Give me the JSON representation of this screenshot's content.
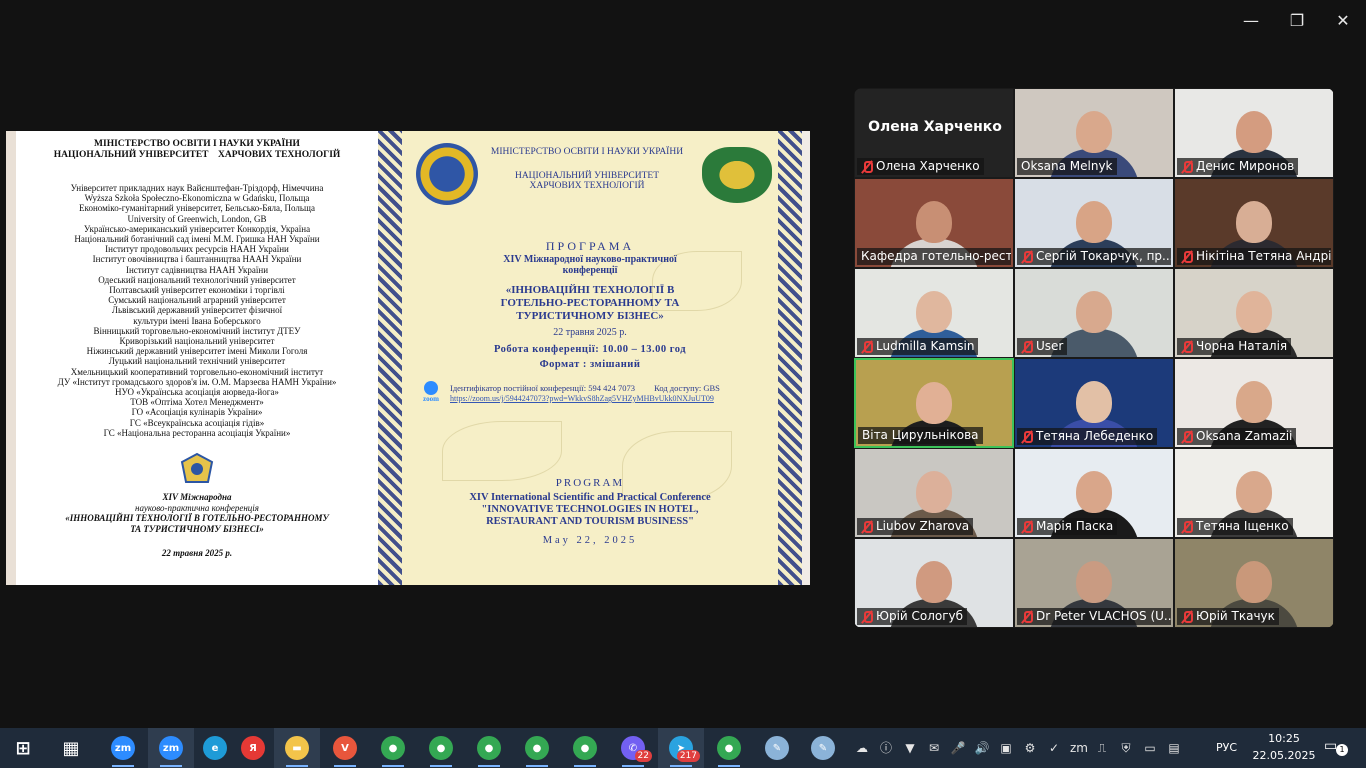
{
  "window": {
    "minimize": "—",
    "maximize": "❐",
    "close": "✕"
  },
  "slide": {
    "left": {
      "ministry": "МІНІСТЕРСТВО ОСВІТИ І НАУКИ УКРАЇНИ",
      "university": "НАЦІОНАЛЬНИЙ УНІВЕРСИТЕТ    ХАРЧОВИХ ТЕХНОЛОГІЙ",
      "partners": [
        "Університет прикладних наук Вайєнштефан-Тріздорф, Німеччина",
        "Wyższa Szkoła Społeczno-Ekonomiczna w Gdańsku, Польща",
        "Економіко-гуманітарний університет, Бельсько-Бяла, Польща",
        "University of Greenwich, London, GB",
        "Українсько-американський університет Конкордія, Україна",
        "Національний ботанічний сад імені М.М. Гришка НАН України",
        "Інститут продовольчих ресурсів НААН України",
        "Інститут овочівництва і баштанництва НААН України",
        "Інститут садівництва НААН України",
        "Одеський національний технологічний університет",
        "Полтавський університет економіки і торгівлі",
        "Сумський національний аграрний університет",
        "Львівський державний університет фізичної",
        "культури імені Івана Боберського",
        "Вінницький торговельно-економічний інститут ДТЕУ",
        "Криворізький національний університет",
        "Ніжинський державний університет імені Миколи Гоголя",
        "Луцький національний технічний університет",
        "Хмельницький кооперативний торговельно-економічний інститут",
        "ДУ «Інститут громадського здоров'я ім. О.М. Марзеєва НАМН України»",
        "НУО «Українська асоціація аюрведа-йога»",
        "ТОВ «Оптіма Хотел Менеджмент»",
        "ГО «Асоціація кулінарів України»",
        "ГС «Всеукраїнська асоціація гідів»",
        "ГС «Національна ресторанна асоціація України»"
      ],
      "conf_number": "XIV Міжнародна",
      "conf_type": "науково-практична конференція",
      "conf_name_1": "«ІННОВАЦІЙНІ ТЕХНОЛОГІЇ В ГОТЕЛЬНО-РЕСТОРАННОМУ",
      "conf_name_2": "ТА ТУРИСТИЧНОМУ БІЗНЕСІ»",
      "date": "22 травня 2025 р."
    },
    "right": {
      "ministry": "МІНІСТЕРСТВО ОСВІТИ І НАУКИ УКРАЇНИ",
      "university_1": "НАЦІОНАЛЬНИЙ УНІВЕРСИТЕТ",
      "university_2": "ХАРЧОВИХ ТЕХНОЛОГІЙ",
      "program": "ПРОГРАМА",
      "sub_1": "XIV Міжнародної науково-практичної",
      "sub_2": "конференції",
      "name_1": "«ІННОВАЦІЙНІ ТЕХНОЛОГІЇ В",
      "name_2": "ГОТЕЛЬНО-РЕСТОРАННОМУ ТА",
      "name_3": "ТУРИСТИЧНОМУ БІЗНЕС»",
      "date": "22 травня 2025 р.",
      "time": "Робота конференції:  10.00 – 13.00 год",
      "format": "Формат : змішаний",
      "zoom_label": "zoom",
      "zoom_id": "Ідентифікатор постійної конференції: 594 424 7073         Код доступу: GBS",
      "zoom_link": "https://zoom.us/j/5944247073?pwd=WkkvS8hZag5VHZyMHBvUkk0NXJuUT09",
      "en_program": "PROGRAM",
      "en_sub": "XIV International Scientific and Practical Conference",
      "en_name_1": "\"INNOVATIVE TECHNOLOGIES IN HOTEL,",
      "en_name_2": "RESTAURANT AND TOURISM BUSINESS\"",
      "en_date": "May 22, 2025"
    }
  },
  "participants": [
    {
      "name": "Олена Харченко",
      "muted": false,
      "video": false
    },
    {
      "name": "Olena Харченко",
      "muted": true,
      "video": false,
      "label_only": true
    },
    {
      "name": "Oksana Melnyk",
      "muted": false,
      "video": true,
      "bg": "#cfc8c0",
      "skin": "#d9a88c",
      "shirt": "#3a4a7a"
    },
    {
      "name": "Денис Миронов",
      "muted": true,
      "video": true,
      "bg": "#e8e8e6",
      "skin": "#d49c80",
      "shirt": "#2a3340"
    },
    {
      "name": "Кафедра готельно-рест...",
      "muted": false,
      "video": true,
      "bg": "#8a4a3a",
      "skin": "#c88f74",
      "shirt": "#d9d3d0"
    },
    {
      "name": "Сергій Токарчук, пр...",
      "muted": true,
      "video": true,
      "bg": "#d8dee6",
      "skin": "#d8a486",
      "shirt": "#2c3e5a"
    },
    {
      "name": "Нікітіна Тетяна Андрі...",
      "muted": true,
      "video": true,
      "bg": "#5a3a2a",
      "skin": "#d8ae95",
      "shirt": "#2c2a30"
    },
    {
      "name": "Ludmilla Kamsin",
      "muted": true,
      "video": true,
      "bg": "#e4e6e2",
      "skin": "#e0b79e",
      "shirt": "#2f5e9a"
    },
    {
      "name": "User",
      "muted": true,
      "video": true,
      "bg": "#d9dcd8",
      "skin": "#d8a98e",
      "shirt": "#4a5a6a"
    },
    {
      "name": "Чорна Наталія",
      "muted": true,
      "video": true,
      "bg": "#d7d3c9",
      "skin": "#e0b49a",
      "shirt": "#2b2b2b"
    },
    {
      "name": "Віта Цирульнікова",
      "muted": false,
      "video": true,
      "bg": "#b8a050",
      "skin": "#e1b095",
      "shirt": "#1e1e1e",
      "active": true
    },
    {
      "name": "Тетяна Лебеденко",
      "muted": true,
      "video": true,
      "bg": "#1c3a7a",
      "skin": "#e2c0a6",
      "shirt": "#3a4ea8"
    },
    {
      "name": "Oksana Zamazii",
      "muted": true,
      "video": true,
      "bg": "#ece8e4",
      "skin": "#d9a88a",
      "shirt": "#222222"
    },
    {
      "name": "Liubov Zharova",
      "muted": true,
      "video": true,
      "bg": "#c9c7c2",
      "skin": "#dcb09a",
      "shirt": "#6b5a4a"
    },
    {
      "name": "Марія Паска",
      "muted": true,
      "video": true,
      "bg": "#e7ecf1",
      "skin": "#d9a68a",
      "shirt": "#1a1a1a"
    },
    {
      "name": "Тетяна Іщенко",
      "muted": true,
      "video": true,
      "bg": "#efeeea",
      "skin": "#d9a88c",
      "shirt": "#3b3b3b"
    },
    {
      "name": "Юрій Сологуб",
      "muted": true,
      "video": true,
      "bg": "#dfe2e4",
      "skin": "#d09a80",
      "shirt": "#3a3a3a"
    },
    {
      "name": "Dr Peter VLACHOS (U...",
      "muted": true,
      "video": true,
      "bg": "#a9a394",
      "skin": "#c99b82",
      "shirt": "#35383e"
    },
    {
      "name": "Юрій Ткачук",
      "muted": true,
      "video": true,
      "bg": "#8f8568",
      "skin": "#c9987a",
      "shirt": "#4c4a40"
    }
  ],
  "taskbar": {
    "apps": [
      {
        "name": "start",
        "label": "⊞",
        "color": "#ffffff"
      },
      {
        "name": "task-view",
        "label": "▦",
        "color": "#ffffff"
      },
      {
        "name": "zoom-1",
        "label": "zm",
        "color": "#2d8cff",
        "open": true
      },
      {
        "name": "zoom-2",
        "label": "zm",
        "color": "#2d8cff",
        "open": true,
        "active": true
      },
      {
        "name": "edge",
        "label": "e",
        "color": "#1e9bd7"
      },
      {
        "name": "yandex",
        "label": "Я",
        "color": "#e53935"
      },
      {
        "name": "explorer",
        "label": "▬",
        "color": "#f3c44a",
        "open": true,
        "active": true
      },
      {
        "name": "vivaldi",
        "label": "V",
        "color": "#e8563c",
        "open": true
      },
      {
        "name": "chrome-1",
        "label": "●",
        "color": "#34a853",
        "open": true
      },
      {
        "name": "chrome-2",
        "label": "●",
        "color": "#34a853",
        "open": true
      },
      {
        "name": "chrome-3",
        "label": "●",
        "color": "#34a853",
        "open": true
      },
      {
        "name": "chrome-4",
        "label": "●",
        "color": "#34a853",
        "open": true
      },
      {
        "name": "chrome-5",
        "label": "●",
        "color": "#34a853",
        "open": true
      },
      {
        "name": "viber",
        "label": "✆",
        "color": "#7360f2",
        "badge": "22",
        "open": true
      },
      {
        "name": "telegram",
        "label": "➤",
        "color": "#2aa3e0",
        "badge": "217",
        "open": true,
        "active": true
      },
      {
        "name": "chrome-6",
        "label": "●",
        "color": "#34a853",
        "open": true
      },
      {
        "name": "paint-1",
        "label": "✎",
        "color": "#8bb3d8"
      },
      {
        "name": "paint-2",
        "label": "✎",
        "color": "#8bb3d8"
      }
    ],
    "tray": [
      "☁",
      "ⓘ",
      "▼",
      "✉",
      "🎤",
      "🔊",
      "▣",
      "⚙",
      "✓",
      "zm",
      "⎍",
      "⛨",
      "▭",
      "▤"
    ],
    "language": "РУС",
    "time": "10:25",
    "date": "22.05.2025",
    "notifications": "1"
  }
}
